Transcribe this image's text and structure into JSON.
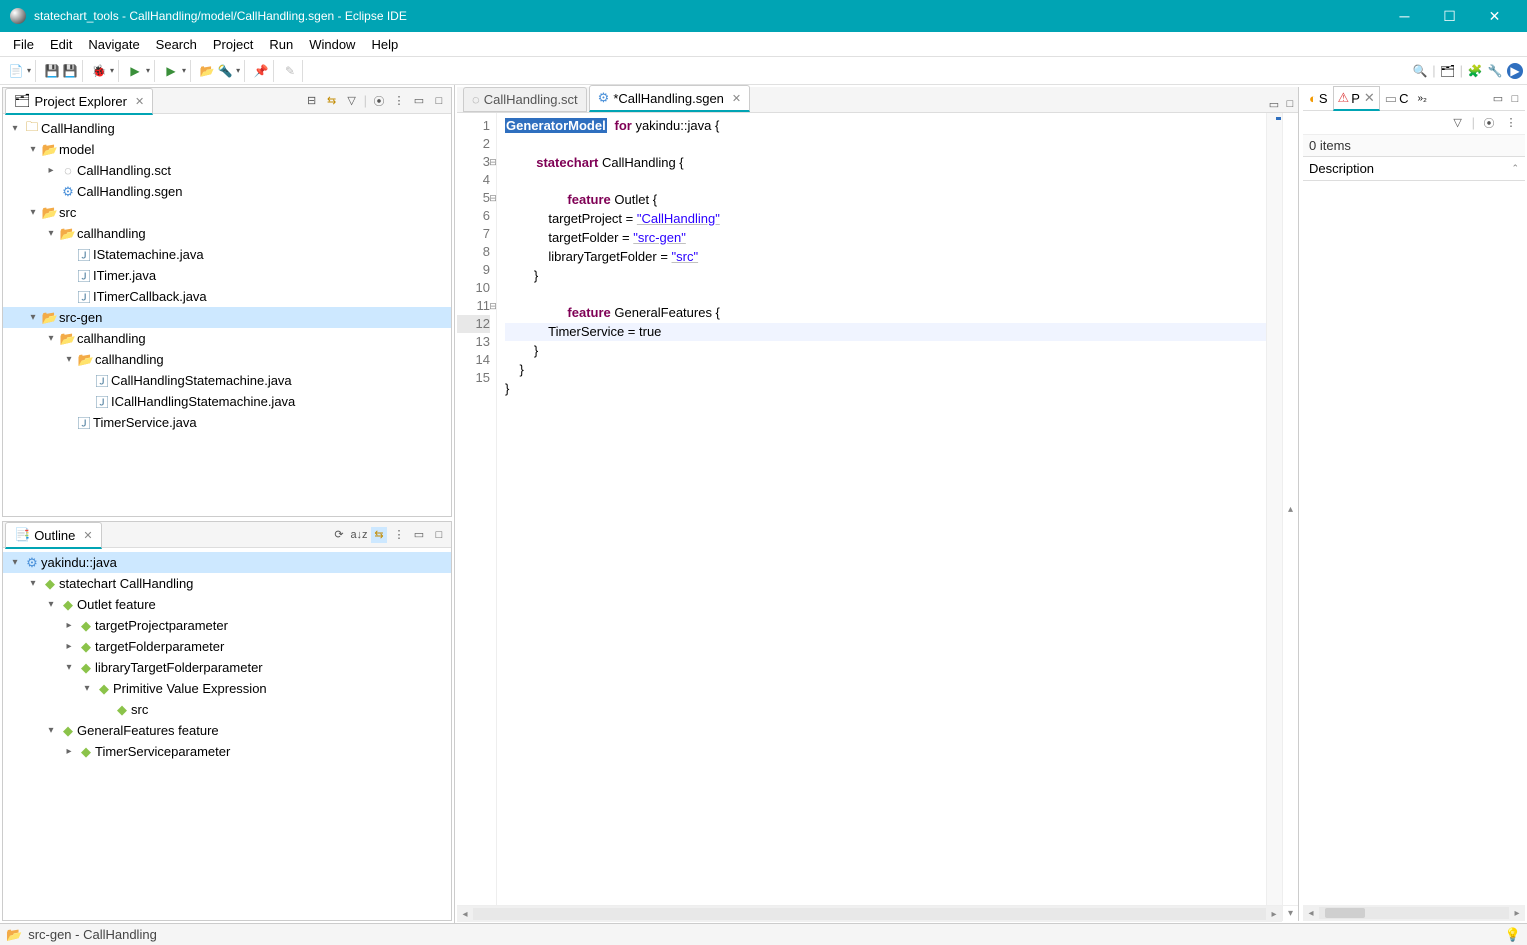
{
  "window": {
    "title": "statechart_tools - CallHandling/model/CallHandling.sgen - Eclipse IDE"
  },
  "menu": {
    "file": "File",
    "edit": "Edit",
    "navigate": "Navigate",
    "search": "Search",
    "project": "Project",
    "run": "Run",
    "window": "Window",
    "help": "Help"
  },
  "explorer": {
    "title": "Project Explorer",
    "project": "CallHandling",
    "model": "model",
    "sct": "CallHandling.sct",
    "sgen": "CallHandling.sgen",
    "src": "src",
    "pkg1": "callhandling",
    "f1": "IStatemachine.java",
    "f2": "ITimer.java",
    "f3": "ITimerCallback.java",
    "srcgen": "src-gen",
    "pkg2": "callhandling",
    "pkg3": "callhandling",
    "g1": "CallHandlingStatemachine.java",
    "g2": "ICallHandlingStatemachine.java",
    "g3": "TimerService.java"
  },
  "outline": {
    "title": "Outline",
    "root": "yakindu::java",
    "sc": "statechart CallHandling",
    "outlet": "Outlet feature",
    "tp": "targetProjectparameter",
    "tf": "targetFolderparameter",
    "ltf": "libraryTargetFolderparameter",
    "pve": "Primitive Value Expression",
    "srcv": "src",
    "gf": "GeneralFeatures feature",
    "ts": "TimerServiceparameter"
  },
  "editor": {
    "tab1": "CallHandling.sct",
    "tab2": "*CallHandling.sgen",
    "lines": [
      "1",
      "2",
      "3",
      "4",
      "5",
      "6",
      "7",
      "8",
      "9",
      "10",
      "11",
      "12",
      "13",
      "14",
      "15"
    ],
    "t_genmodel": "GeneratorModel",
    "t_for": "for",
    "t_yj": " yakindu::java {",
    "t_sc": "statechart",
    "t_ch": " CallHandling {",
    "t_feat": "feature",
    "t_outlet": " Outlet {",
    "t_tp": "            targetProject = ",
    "t_tp_v": "\"CallHandling\"",
    "t_tf": "            targetFolder = ",
    "t_tf_v": "\"src-gen\"",
    "t_ltf": "            libraryTargetFolder = ",
    "t_ltf_v": "\"src\"",
    "t_cb": "        }",
    "t_gf": " GeneralFeatures {",
    "t_ts": "            TimerService = true",
    "t_cb2": "    }",
    "t_cb3": "}"
  },
  "right": {
    "s": "S",
    "p": "P",
    "c": "C",
    "items": "0 items",
    "col": "Description"
  },
  "status": {
    "path": "src-gen - CallHandling"
  }
}
